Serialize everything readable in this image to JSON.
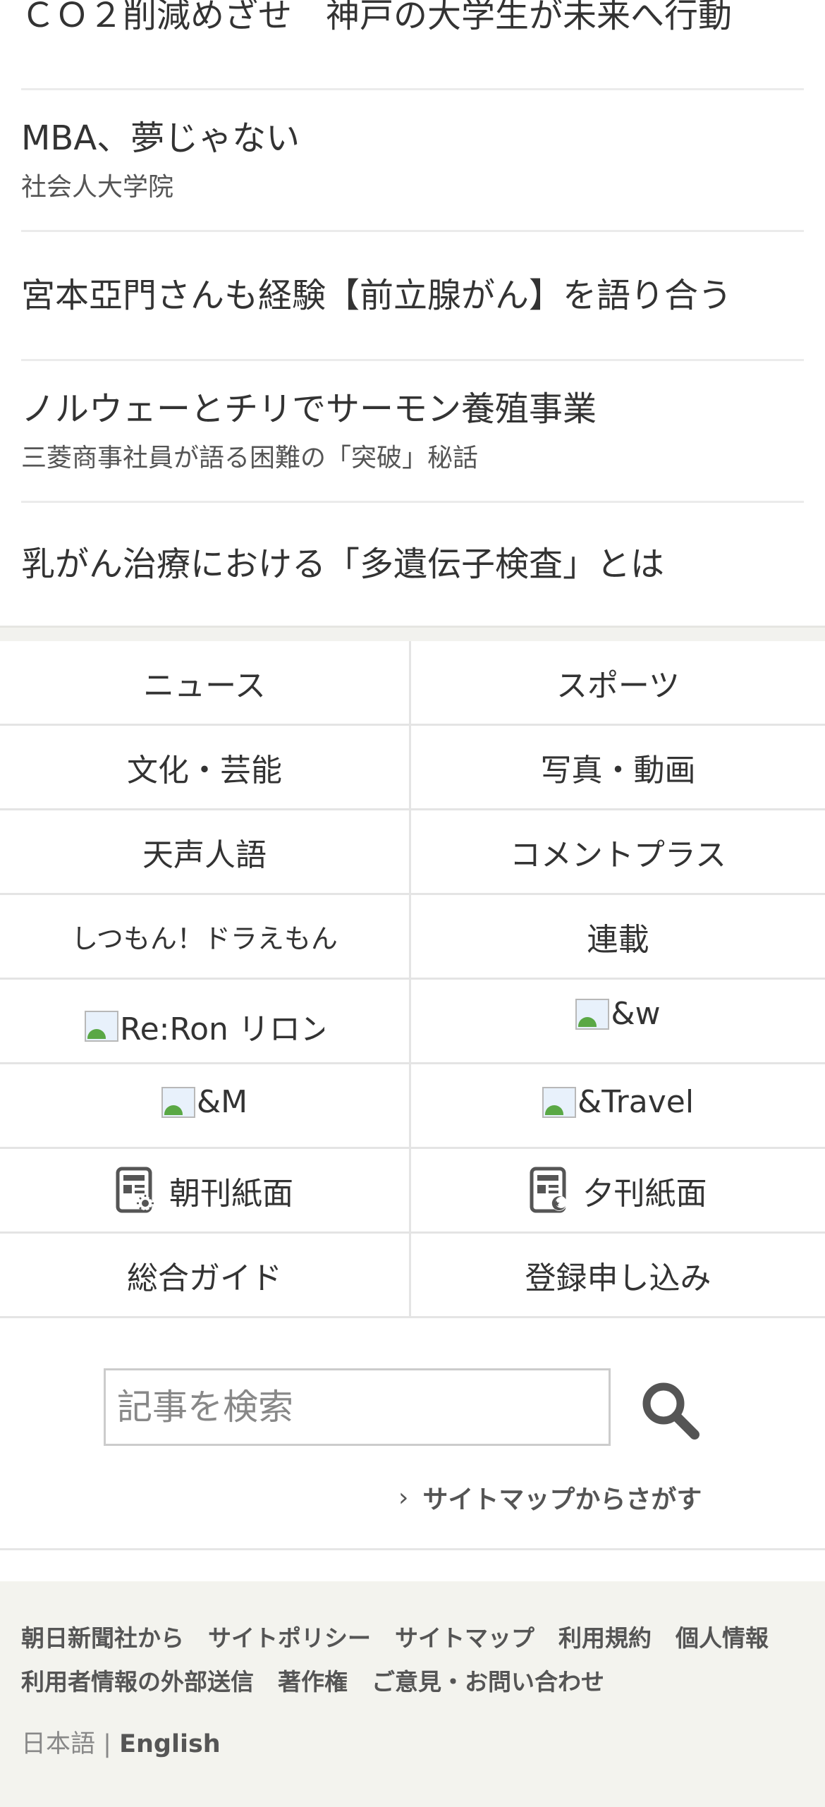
{
  "articles": [
    {
      "title": "ＣＯ２削減めざせ　神戸の大学生が未来へ行動"
    },
    {
      "title": "MBA、夢じゃない",
      "sub": "社会人大学院"
    },
    {
      "title": "宮本亞門さんも経験【前立腺がん】を語り合う"
    },
    {
      "title": "ノルウェーとチリでサーモン養殖事業",
      "sub": "三菱商事社員が語る困難の「突破」秘話"
    },
    {
      "title": "乳がん治療における「多遺伝子検査」とは"
    }
  ],
  "menu": {
    "news": "ニュース",
    "sports": "スポーツ",
    "culture": "文化・芸能",
    "photo_video": "写真・動画",
    "tenseijingo": "天声人語",
    "comment_plus": "コメントプラス",
    "doraemon": "しつもん！ドラえもん",
    "series": "連載",
    "reron": "Re:Ron リロン",
    "andw": "&w",
    "andm": "&M",
    "andtravel": "&Travel",
    "morning_paper": "朝刊紙面",
    "evening_paper": "夕刊紙面",
    "guide": "総合ガイド",
    "register": "登録申し込み"
  },
  "search": {
    "placeholder": "記事を検索",
    "sitemap_link": "サイトマップからさがす"
  },
  "footer": {
    "links": [
      "朝日新聞社から",
      "サイトポリシー",
      "サイトマップ",
      "利用規約",
      "個人情報",
      "利用者情報の外部送信",
      "著作権",
      "ご意見・お問い合わせ"
    ],
    "lang_ja": "日本語",
    "lang_sep": "|",
    "lang_en": "English"
  },
  "icons": {
    "search": "search-icon",
    "morning": "newspaper-sun-icon",
    "evening": "newspaper-moon-icon",
    "broken_image": "broken-image-icon",
    "chevron": "chevron-right-icon"
  },
  "colors": {
    "text": "#333333",
    "search_icon": "#555555",
    "footer_bg": "#f3f3ee",
    "divider": "#e4e4e4"
  }
}
